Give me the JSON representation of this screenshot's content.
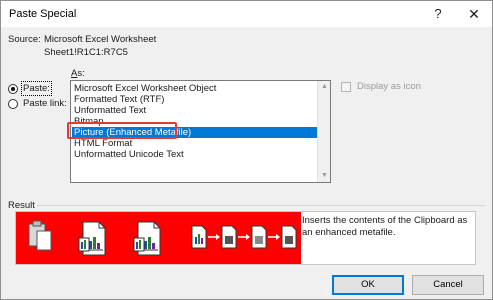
{
  "window": {
    "title": "Paste Special",
    "help_icon": "question-mark-icon",
    "close_icon": "close-x-icon"
  },
  "source": {
    "label": "Source:",
    "line1": "Microsoft Excel Worksheet",
    "line2": "Sheet1!R1C1:R7C5"
  },
  "as_label_underlined": "A",
  "as_label_rest": "s:",
  "paste_options": [
    {
      "label": "Paste:",
      "checked": true
    },
    {
      "label": "Paste link:",
      "checked": false
    }
  ],
  "formats": [
    {
      "label": "Microsoft Excel Worksheet Object",
      "selected": false
    },
    {
      "label": "Formatted Text (RTF)",
      "selected": false
    },
    {
      "label": "Unformatted Text",
      "selected": false
    },
    {
      "label": "Bitmap",
      "selected": false
    },
    {
      "label": "Picture (Enhanced Metafile)",
      "selected": true
    },
    {
      "label": "HTML Format",
      "selected": false
    },
    {
      "label": "Unformatted Unicode Text",
      "selected": false
    }
  ],
  "display_as_icon": {
    "label": "Display as icon",
    "checked": false,
    "enabled": false
  },
  "result": {
    "label": "Result",
    "description": "Inserts the contents of the Clipboard as an enhanced metafile."
  },
  "buttons": {
    "ok": "OK",
    "cancel": "Cancel"
  },
  "colors": {
    "accent": "#0078d7",
    "highlight_box": "#e53935",
    "result_band": "#ff0000"
  }
}
